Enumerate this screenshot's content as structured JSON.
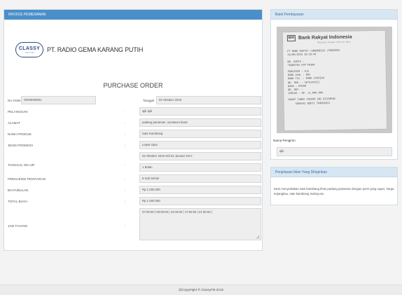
{
  "invoice": {
    "header_title": "INVOICE PEMESANAN",
    "logo_brand": "CLASSY",
    "logo_freq": "103.4 FM",
    "company_name": "PT. RADIO GEMA KARANG PUTIH",
    "doc_title": "PURCHASE ORDER",
    "no_order_label": "No Order",
    "no_order_value": "OD00000001",
    "tanggal_label": "Tanggal",
    "tanggal_value": "02 Oktober 2018",
    "colon": ":",
    "fields": [
      {
        "label": "PELANGGAN",
        "value": "ajik ajik"
      },
      {
        "label": "ALAMAT",
        "value": "padang pariaman, sumatera barat"
      },
      {
        "label": "NAMA PRODUK",
        "value": "Sate Kambiang"
      },
      {
        "label": "JENIS PROMOSI",
        "value": "Lepas Spot"
      },
      {
        "label": "TANGGAL ON AIR",
        "value_line1": "02 Oktober 2018 S/d 02 Januari 2017",
        "value_line2": "1 Bulan"
      },
      {
        "label": "FREKUENSI PENYIARAN",
        "value": "5 Kali Sehari"
      },
      {
        "label": "BIAYA/BULAN",
        "value": "Rp 1.000.000"
      },
      {
        "label": "TOTAL BIAYA",
        "value": "Rp 1.000.000"
      },
      {
        "label": "JAM TAYANG",
        "value": "07:00:00 | 09:00:00 | 10:00:00 | 17:00:00 | 21:00:00 |"
      }
    ]
  },
  "bukti": {
    "header_title": "Bukti Pembayaran",
    "receipt": {
      "logo_text": "BRI",
      "bank_name": "Bank Rakyat Indonesia",
      "bank_sub": "Melayani Dengan Setulus Hati",
      "lines": [
        "PT BANK RAKYAT (INDONESIA (PERSERO)",
        "24/06/2018  18:18:44",
        "",
        "NO. KARTU :",
        "TRANSFER ATM PRIMA",
        "",
        "PENGIRIM   : AJS",
        "BANK ASAL  : BRI",
        "BANK TUJ.  : BANK SYARIAH",
        "NO. REK.   : 5676345251",
        "NAMA       : ERSAB",
        "NO. REF.   :",
        "JUMLAH     : RP.  11.000.000",
        "",
        "HARAP TANDA TERIMA INI DISIMPAN",
        "SEBAGAI BUKTI TRANSAKSI"
      ]
    },
    "pengirim_label": "Nama Pengirim",
    "pengirim_value": "ajik"
  },
  "penjelasan": {
    "header_title": "Penjelasan Iklan Yang Diinginkan",
    "text": "kami menyediakan sate kambiang khas padang pariaman dengan porsi yang super, harga terjangkau, sate kambiang maknyuss."
  },
  "footer": {
    "text": "@CopyRight ® ClassyFM  2018"
  }
}
